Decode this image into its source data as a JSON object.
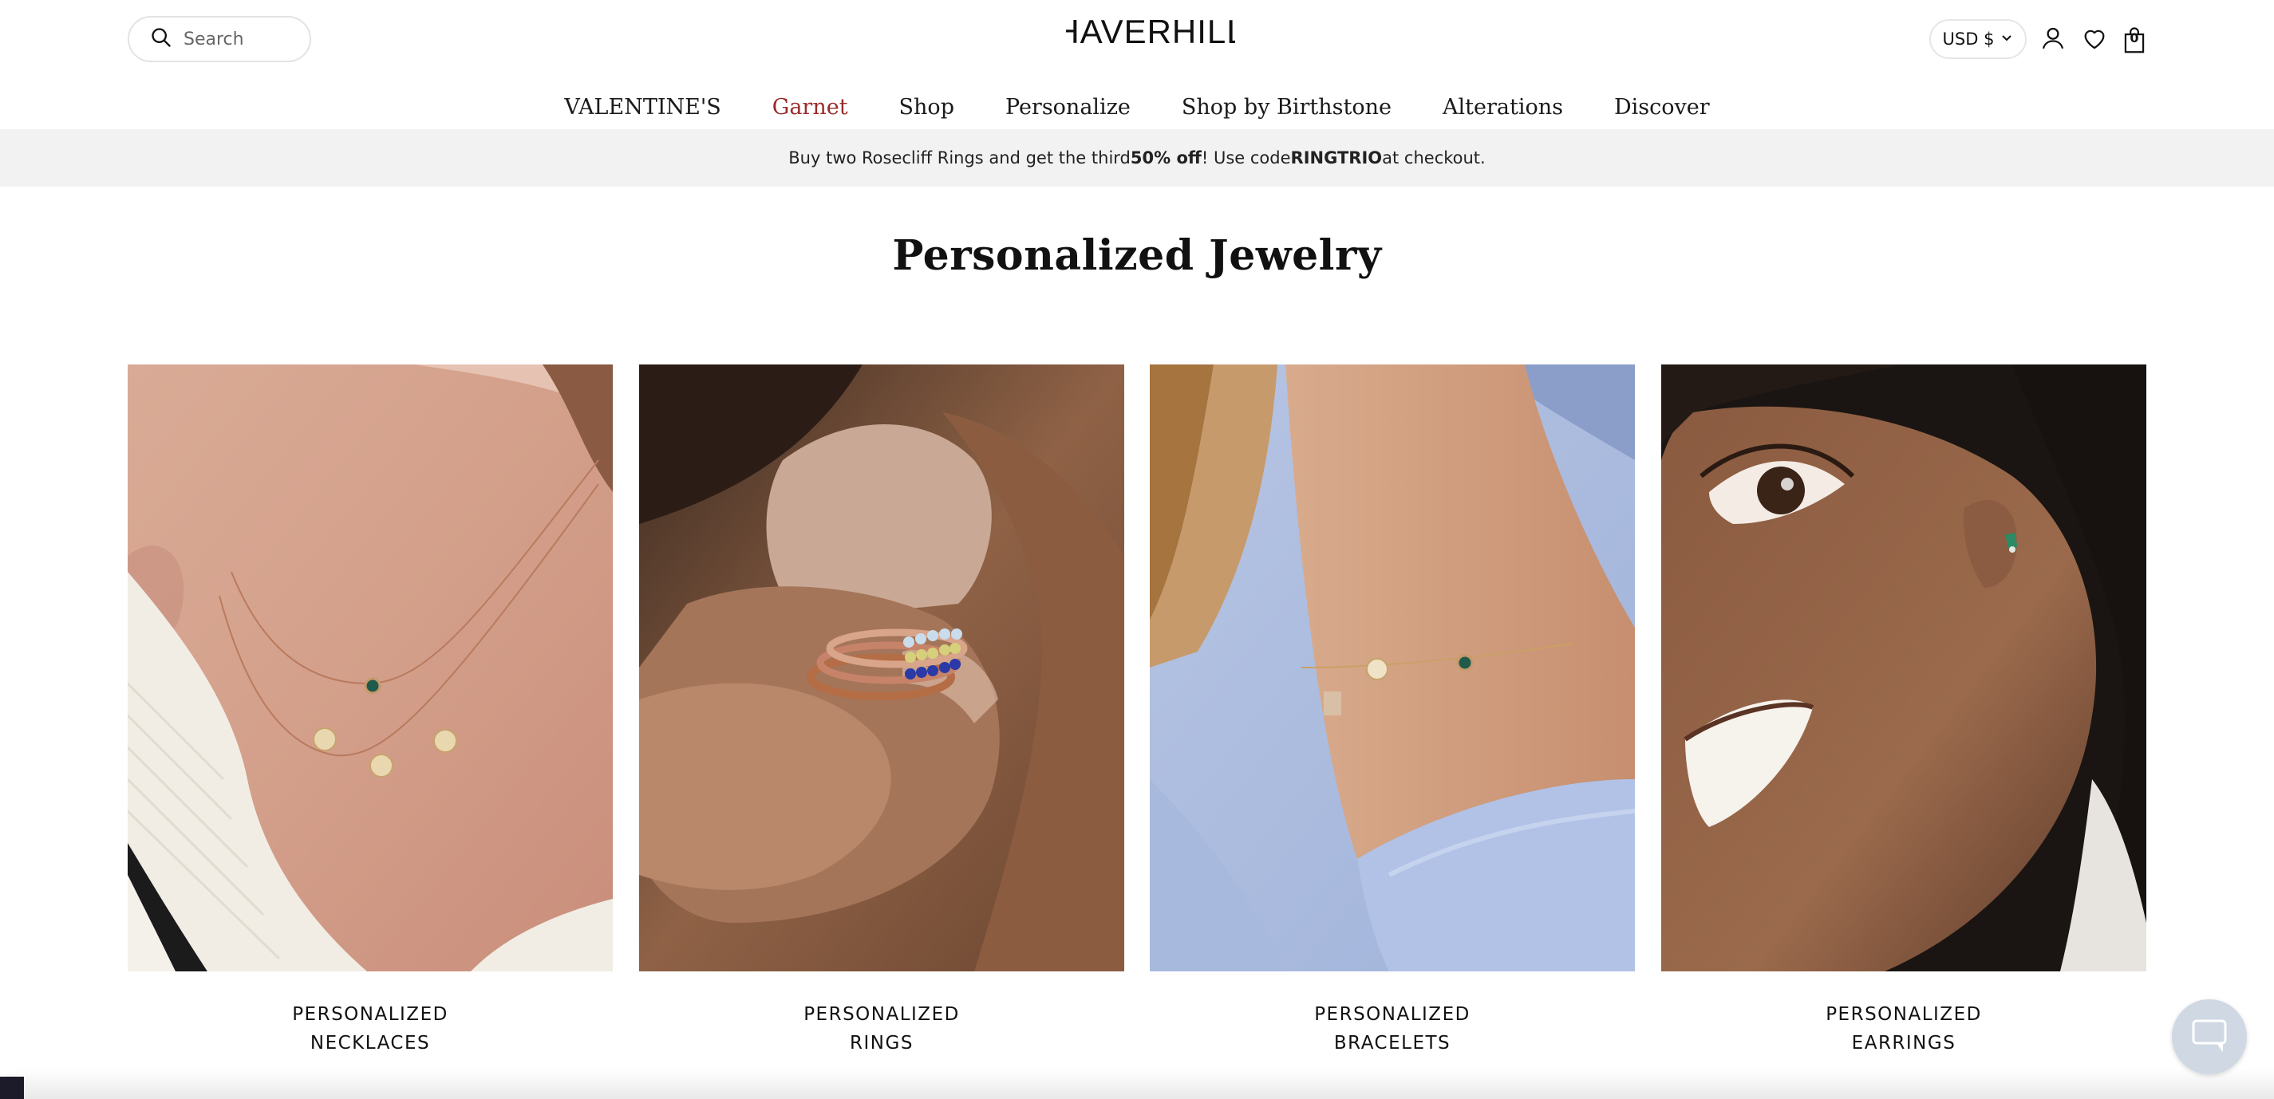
{
  "header": {
    "search_placeholder": "Search",
    "logo": "HAVERHILL",
    "currency": "USD $",
    "cart_count": "0"
  },
  "nav": [
    {
      "label": "VALENTINE'S"
    },
    {
      "label": "Garnet"
    },
    {
      "label": "Shop"
    },
    {
      "label": "Personalize"
    },
    {
      "label": "Shop by Birthstone"
    },
    {
      "label": "Alterations"
    },
    {
      "label": "Discover"
    }
  ],
  "promo": {
    "prefix": "Buy two Rosecliff Rings and get the third ",
    "bold1": "50% off",
    "middle": "! Use code ",
    "bold2": "RINGTRIO",
    "suffix": " at checkout."
  },
  "page": {
    "title": "Personalized Jewelry"
  },
  "cards": [
    {
      "line1": "PERSONALIZED",
      "line2": "NECKLACES"
    },
    {
      "line1": "PERSONALIZED",
      "line2": "RINGS"
    },
    {
      "line1": "PERSONALIZED",
      "line2": "BRACELETS"
    },
    {
      "line1": "PERSONALIZED",
      "line2": "EARRINGS"
    }
  ],
  "colors": {
    "accent": "#9b2b2b",
    "promo_bg": "#f2f2f2",
    "chat_bg": "#cfd8e3"
  },
  "icons": [
    "search-icon",
    "chevron-down-icon",
    "account-icon",
    "heart-icon",
    "bag-icon",
    "chat-icon"
  ]
}
